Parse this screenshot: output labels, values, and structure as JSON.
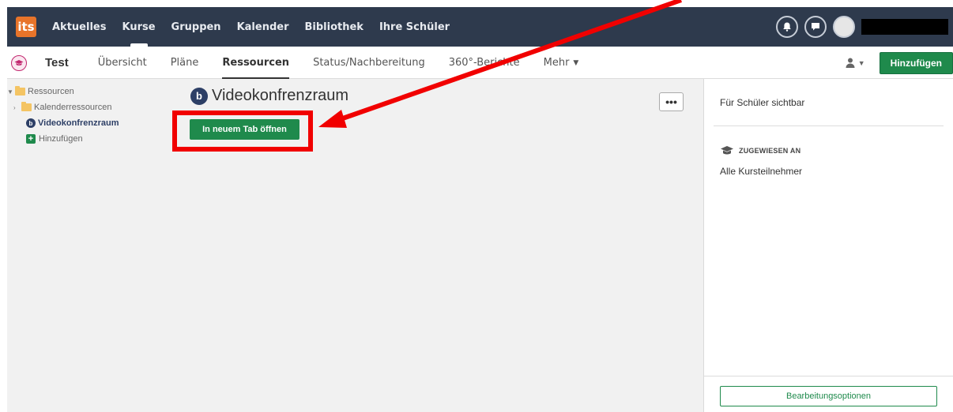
{
  "topbar": {
    "logo_text": "its",
    "nav": [
      "Aktuelles",
      "Kurse",
      "Gruppen",
      "Kalender",
      "Bibliothek",
      "Ihre Schüler"
    ],
    "active_index": 1,
    "icons": [
      "bell-icon",
      "chat-icon",
      "avatar"
    ]
  },
  "course": {
    "title": "Test",
    "tabs": [
      "Übersicht",
      "Pläne",
      "Ressourcen",
      "Status/Nachbereitung",
      "360°-Berichte",
      "Mehr"
    ],
    "active_tab": "Ressourcen",
    "add_label": "Hinzufügen"
  },
  "sidebar": {
    "root": "Ressourcen",
    "items": [
      {
        "label": "Kalenderressourcen",
        "type": "folder"
      },
      {
        "label": "Videokonfrenzraum",
        "type": "bbb",
        "active": true
      },
      {
        "label": "Hinzufügen",
        "type": "add"
      }
    ]
  },
  "main": {
    "resource_title": "Videokonfrenzraum",
    "more_label": "•••",
    "open_button": "In neuem Tab öffnen"
  },
  "right_panel": {
    "visibility": "Für Schüler sichtbar",
    "assigned_heading": "ZUGEWIESEN AN",
    "assigned_value": "Alle Kursteilnehmer",
    "edit_button": "Bearbeitungsoptionen"
  },
  "colors": {
    "topbar": "#2e3a4d",
    "accent_green": "#1f8a4c",
    "annotation_red": "#f10000",
    "logo_orange": "#e8742a"
  }
}
